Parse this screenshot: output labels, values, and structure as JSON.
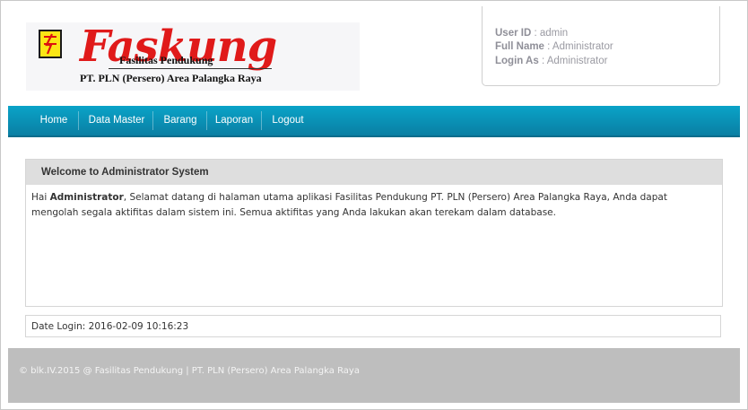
{
  "logo": {
    "title": "askung",
    "title_initial": "F",
    "subtitle": "Fasilitas Pendukung",
    "organization": "PT. PLN (Persero) Area Palangka Raya"
  },
  "user": {
    "id_label": "User ID",
    "id_value": "admin",
    "name_label": "Full Name",
    "name_value": "Administrator",
    "role_label": "Login As",
    "role_value": "Administrator"
  },
  "nav": {
    "items": [
      "Home",
      "Data Master",
      "Barang",
      "Laporan",
      "Logout"
    ]
  },
  "welcome": {
    "title": "Welcome to Administrator System",
    "greeting": "Hai",
    "user_name": "Administrator",
    "message": ", Selamat datang di halaman utama aplikasi Fasilitas Pendukung PT. PLN (Persero) Area Palangka Raya, Anda dapat mengolah segala aktifitas dalam sistem ini. Semua aktifitas yang Anda lakukan akan terekam dalam database."
  },
  "login_info": {
    "label": "Date Login:",
    "value": "2016-02-09 10:16:23"
  },
  "footer": {
    "text": "© blk.IV.2015 @ Fasilitas Pendukung | PT. PLN (Persero) Area Palangka Raya"
  },
  "colors": {
    "nav": "#0a90b8",
    "logo_red": "#e01a1a",
    "panel_head": "#dedede",
    "footer": "#bebebe"
  }
}
